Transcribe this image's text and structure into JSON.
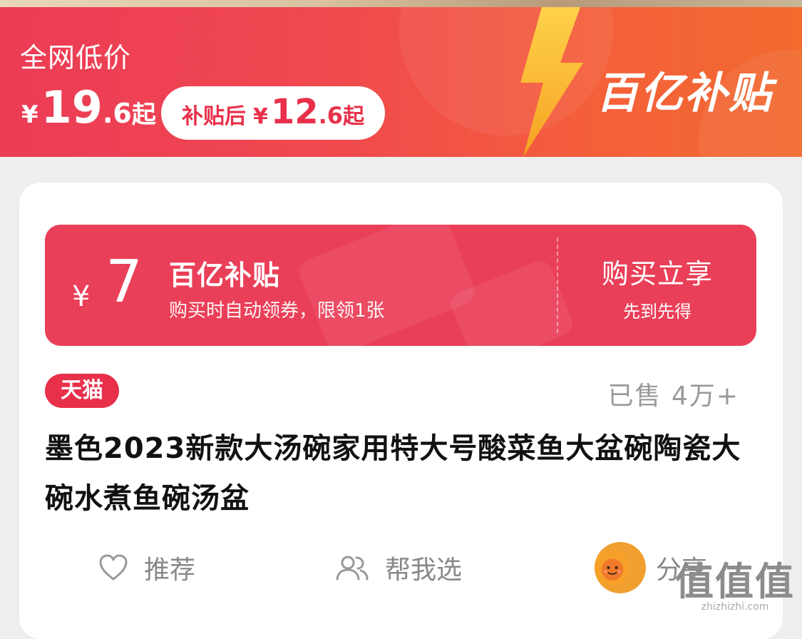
{
  "banner": {
    "low_price_label": "全网低价",
    "price_currency": "¥",
    "price_int": "19",
    "price_dec": ".6",
    "price_suffix": "起",
    "subsidy_label": "补贴后",
    "subsidy_currency": "¥",
    "subsidy_int": "12",
    "subsidy_dec": ".6",
    "subsidy_suffix": "起",
    "brand": "百亿补贴"
  },
  "coupon": {
    "currency": "¥",
    "amount": "7",
    "title": "百亿补贴",
    "description": "购买时自动领券，限领1张",
    "action": "购买立享",
    "note": "先到先得"
  },
  "product": {
    "shop_badge": "天猫",
    "sold": "已售 4万+",
    "title": "墨色2023新款大汤碗家用特大号酸菜鱼大盆碗陶瓷大碗水煮鱼碗汤盆"
  },
  "actions": {
    "recommend": "推荐",
    "help_choose": "帮我选",
    "share": "分享"
  },
  "watermark": {
    "main": "值值值",
    "url": "zhizhizhi.com"
  },
  "colors": {
    "brand_red": "#e8304a",
    "banner_orange": "#f26a2e",
    "coupon_bg": "#ea3f58"
  }
}
